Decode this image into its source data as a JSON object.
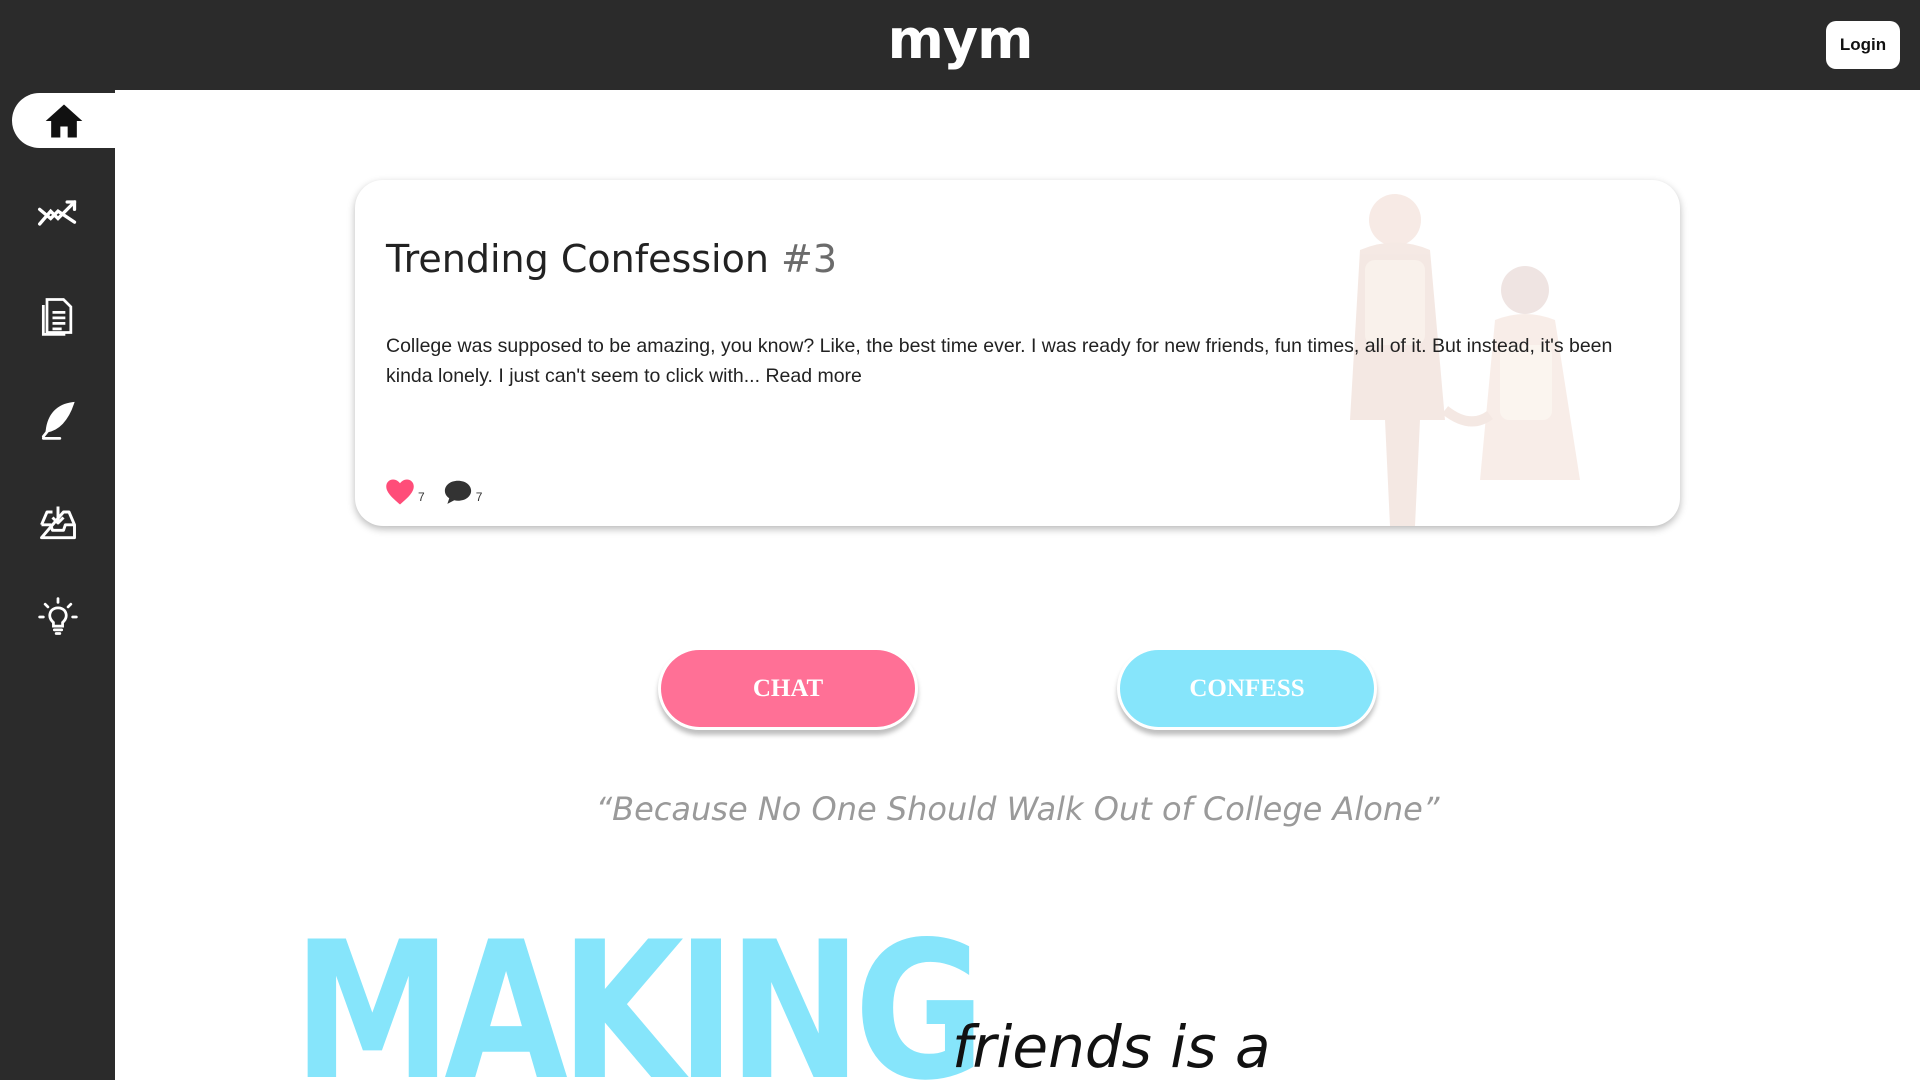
{
  "header": {
    "logo": "mym",
    "login_label": "Login"
  },
  "sidebar": {
    "items": [
      {
        "icon": "home-icon",
        "active": true
      },
      {
        "icon": "trending-icon",
        "active": false
      },
      {
        "icon": "document-icon",
        "active": false
      },
      {
        "icon": "feather-icon",
        "active": false
      },
      {
        "icon": "inbox-download-icon",
        "active": false
      },
      {
        "icon": "lightbulb-icon",
        "active": false
      }
    ]
  },
  "card": {
    "title": "Trending Confession",
    "number": "#3",
    "body": "College was supposed to be amazing, you know? Like, the best time ever. I was ready for new friends, fun times, all of it. But instead, it's been kinda lonely. I just can't seem to click with...",
    "read_more": "Read more",
    "likes": "7",
    "comments": "7"
  },
  "actions": {
    "chat_label": "CHAT",
    "confess_label": "CONFESS"
  },
  "tagline": "“Because No One Should Walk Out of College Alone”",
  "hero": {
    "big_word": "MAKING",
    "small_text": "friends is a"
  },
  "colors": {
    "dark": "#2b2b2b",
    "pink": "#ff7096",
    "cyan": "#86e5fb",
    "heart": "#ff4d79"
  }
}
